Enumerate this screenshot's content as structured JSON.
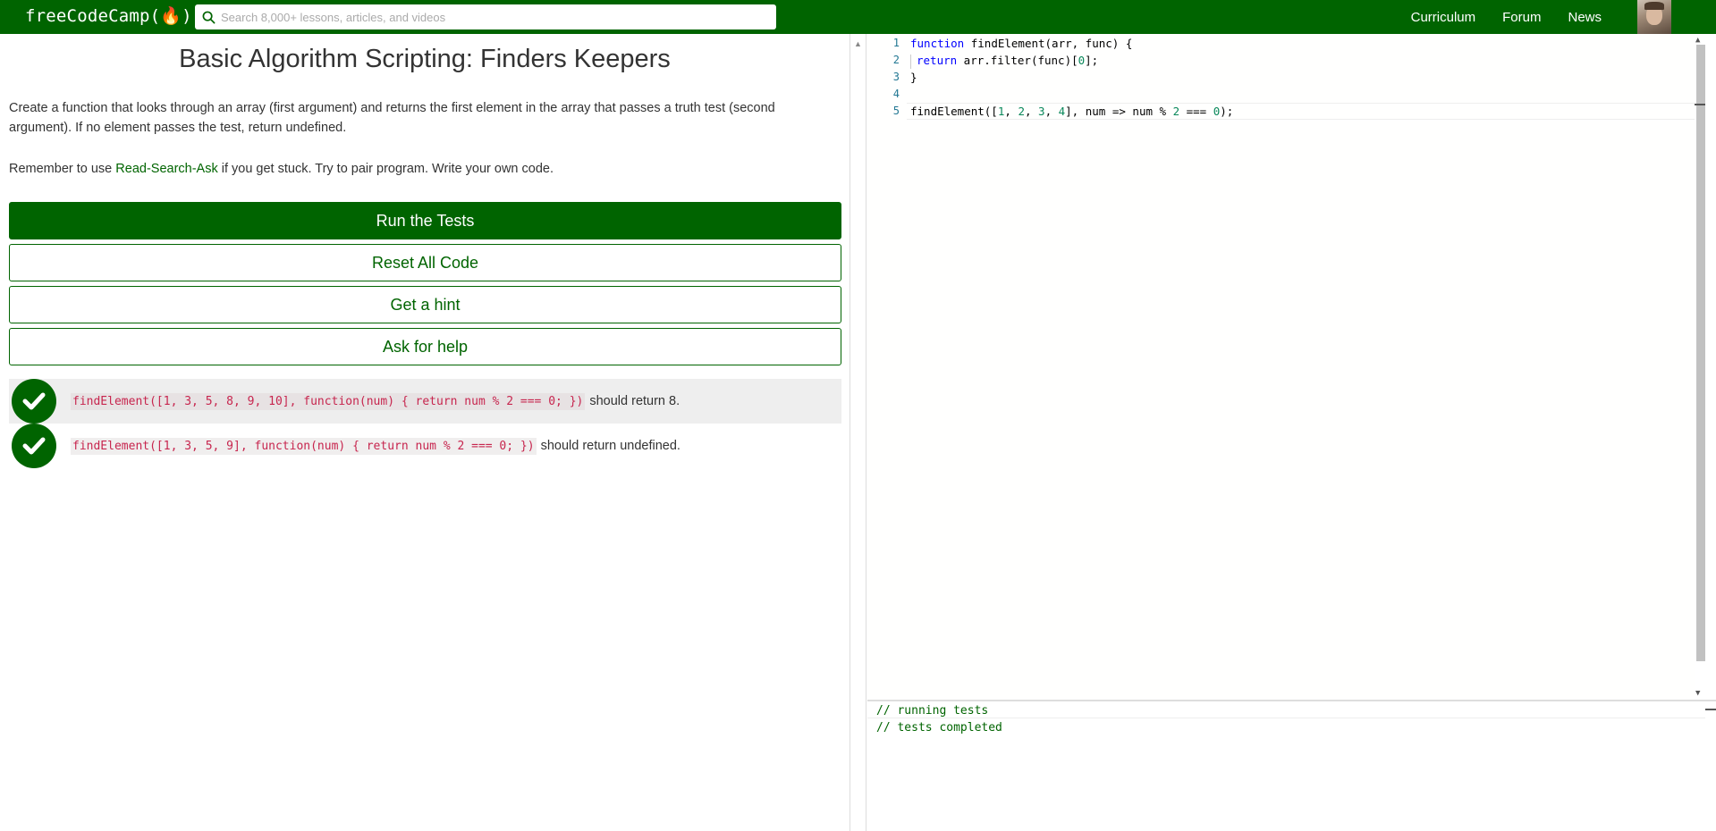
{
  "nav": {
    "logo": "freeCodeCamp(🔥)",
    "search_placeholder": "Search 8,000+ lessons, articles, and videos",
    "links": [
      "Curriculum",
      "Forum",
      "News"
    ]
  },
  "challenge": {
    "title": "Basic Algorithm Scripting: Finders Keepers",
    "description": "Create a function that looks through an array (first argument) and returns the first element in the array that passes a truth test (second argument). If no element passes the test, return undefined.",
    "remember_prefix": "Remember to use ",
    "remember_link": "Read-Search-Ask",
    "remember_suffix": " if you get stuck. Try to pair program. Write your own code."
  },
  "buttons": {
    "run": "Run the Tests",
    "reset": "Reset All Code",
    "hint": "Get a hint",
    "help": "Ask for help"
  },
  "tests": [
    {
      "code": "findElement([1, 3, 5, 8, 9, 10], function(num) { return num % 2 === 0; })",
      "text": "should return 8."
    },
    {
      "code": "findElement([1, 3, 5, 9], function(num) { return num % 2 === 0; })",
      "text": "should return undefined."
    }
  ],
  "editor": {
    "line_numbers": [
      "1",
      "2",
      "3",
      "4",
      "5"
    ]
  },
  "console": {
    "lines": [
      "// running tests",
      "// tests completed"
    ]
  },
  "colors": {
    "brand": "#006400",
    "test_code": "#c7254e"
  }
}
